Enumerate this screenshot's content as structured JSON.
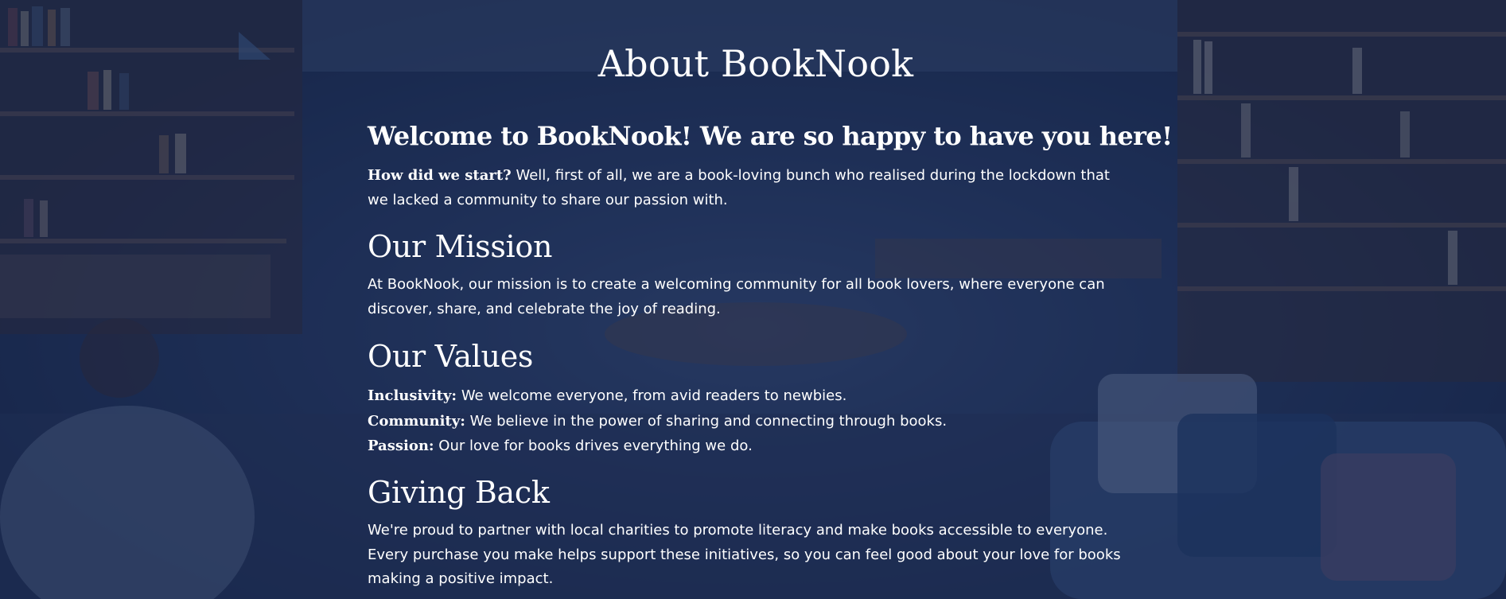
{
  "page": {
    "title": "About BookNook",
    "welcome": "Welcome to BookNook! We are so happy to have you here!",
    "start_label": "How did we start?",
    "start_text": "Well, first of all, we are a book-loving bunch who realised during the lockdown that we lacked a community to share our passion with.",
    "mission_title": "Our Mission",
    "mission_text": "At BookNook, our mission is to create a welcoming community for all book lovers, where everyone can discover, share, and celebrate the joy of reading.",
    "values_title": "Our Values",
    "values": [
      {
        "label": "Inclusivity:",
        "text": "We welcome everyone, from avid readers to newbies."
      },
      {
        "label": "Community:",
        "text": "We believe in the power of sharing and connecting through books."
      },
      {
        "label": "Passion:",
        "text": "Our love for books drives everything we do."
      }
    ],
    "giving_title": "Giving Back",
    "giving_text": "We're proud to partner with local charities to promote literacy and make books accessible to everyone. Every purchase you make helps support these initiatives, so you can feel good about your love for books making a positive impact."
  },
  "background": {
    "description_icon": "bookstore-photo",
    "overlay_color": "#16264e"
  }
}
